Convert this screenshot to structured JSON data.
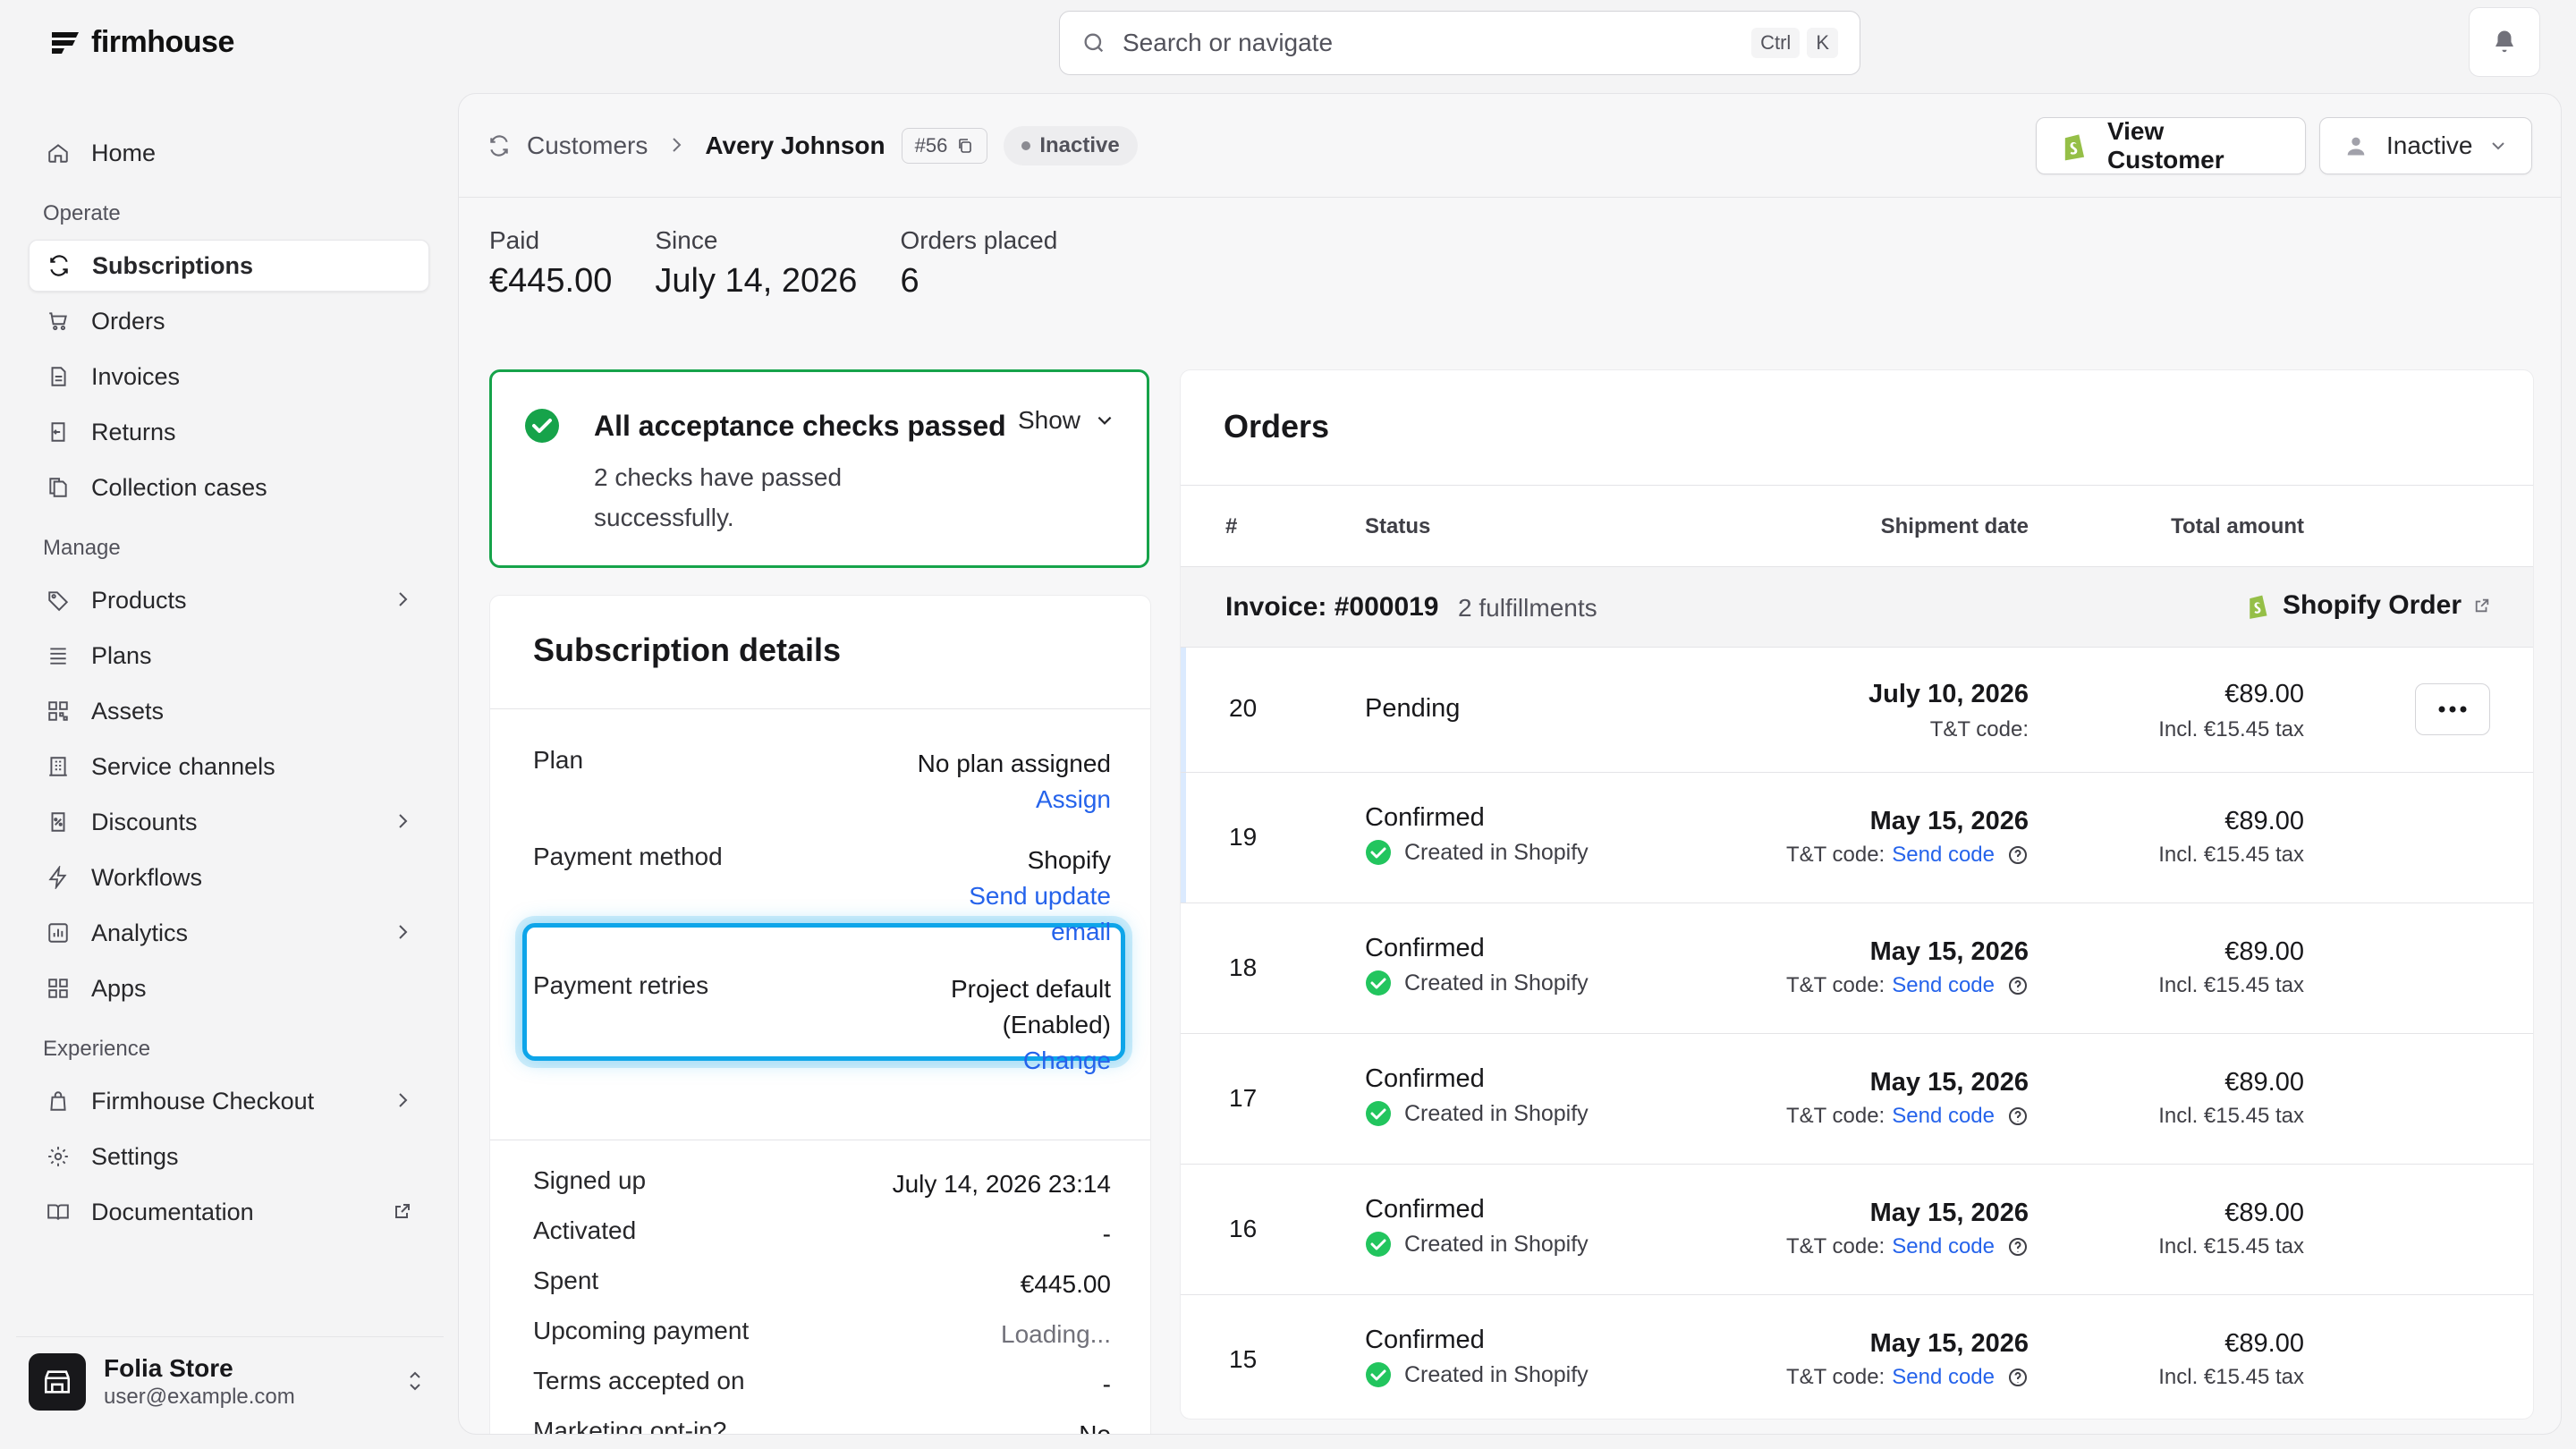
{
  "brand": {
    "name": "firmhouse"
  },
  "search": {
    "placeholder": "Search or navigate",
    "kbd1": "Ctrl",
    "kbd2": "K"
  },
  "sidebar": {
    "home": "Home",
    "operate_label": "Operate",
    "operate": [
      "Subscriptions",
      "Orders",
      "Invoices",
      "Returns",
      "Collection cases"
    ],
    "manage_label": "Manage",
    "manage": [
      "Products",
      "Plans",
      "Assets",
      "Service channels",
      "Discounts",
      "Workflows",
      "Analytics",
      "Apps"
    ],
    "experience_label": "Experience",
    "experience": [
      "Firmhouse Checkout",
      "Settings",
      "Documentation"
    ],
    "store": {
      "name": "Folia Store",
      "email": "user@example.com"
    }
  },
  "header": {
    "crumb": "Customers",
    "current": "Avery Johnson",
    "id": "#56",
    "status": "Inactive",
    "view_customer": "View Customer",
    "state_button": "Inactive"
  },
  "stats": [
    {
      "label": "Paid",
      "value": "€445.00"
    },
    {
      "label": "Since",
      "value": "July 14, 2026"
    },
    {
      "label": "Orders placed",
      "value": "6"
    }
  ],
  "checks": {
    "title": "All acceptance checks passed",
    "show": "Show",
    "subtitle": "2 checks have passed successfully."
  },
  "details": {
    "title": "Subscription details",
    "plan": {
      "label": "Plan",
      "value": "No plan assigned",
      "action": "Assign"
    },
    "payment_method": {
      "label": "Payment method",
      "value": "Shopify",
      "action": "Send update email"
    },
    "payment_retries": {
      "label": "Payment retries",
      "value1": "Project default",
      "value2": "(Enabled)",
      "action": "Change"
    },
    "rows": [
      {
        "label": "Signed up",
        "value": "July 14, 2026 23:14"
      },
      {
        "label": "Activated",
        "value": "-"
      },
      {
        "label": "Spent",
        "value": "€445.00"
      },
      {
        "label": "Upcoming payment",
        "value": "Loading..."
      },
      {
        "label": "Terms accepted on",
        "value": "-"
      },
      {
        "label": "Marketing opt-in?",
        "value": "No"
      }
    ]
  },
  "orders": {
    "title": "Orders",
    "columns": {
      "num": "#",
      "status": "Status",
      "shipment": "Shipment date",
      "total": "Total amount"
    },
    "invoice": {
      "label": "Invoice: #000019",
      "fulfillments": "2 fulfillments",
      "source": "Shopify Order"
    },
    "rows": [
      {
        "num": "20",
        "status": "Pending",
        "sub": "",
        "date": "July 10, 2026",
        "tt_label": "T&T code:",
        "tt_link": "",
        "amount": "€89.00",
        "tax": "Incl. €15.45 tax"
      },
      {
        "num": "19",
        "status": "Confirmed",
        "sub": "Created in Shopify",
        "date": "May 15, 2026",
        "tt_label": "T&T code:",
        "tt_link": "Send code",
        "amount": "€89.00",
        "tax": "Incl. €15.45 tax"
      },
      {
        "num": "18",
        "status": "Confirmed",
        "sub": "Created in Shopify",
        "date": "May 15, 2026",
        "tt_label": "T&T code:",
        "tt_link": "Send code",
        "amount": "€89.00",
        "tax": "Incl. €15.45 tax"
      },
      {
        "num": "17",
        "status": "Confirmed",
        "sub": "Created in Shopify",
        "date": "May 15, 2026",
        "tt_label": "T&T code:",
        "tt_link": "Send code",
        "amount": "€89.00",
        "tax": "Incl. €15.45 tax"
      },
      {
        "num": "16",
        "status": "Confirmed",
        "sub": "Created in Shopify",
        "date": "May 15, 2026",
        "tt_label": "T&T code:",
        "tt_link": "Send code",
        "amount": "€89.00",
        "tax": "Incl. €15.45 tax"
      },
      {
        "num": "15",
        "status": "Confirmed",
        "sub": "Created in Shopify",
        "date": "May 15, 2026",
        "tt_label": "T&T code:",
        "tt_link": "Send code",
        "amount": "€89.00",
        "tax": "Incl. €15.45 tax"
      }
    ]
  },
  "colors": {
    "success": "#16a34a",
    "link": "#2563eb",
    "highlight": "#0ea5e9"
  }
}
